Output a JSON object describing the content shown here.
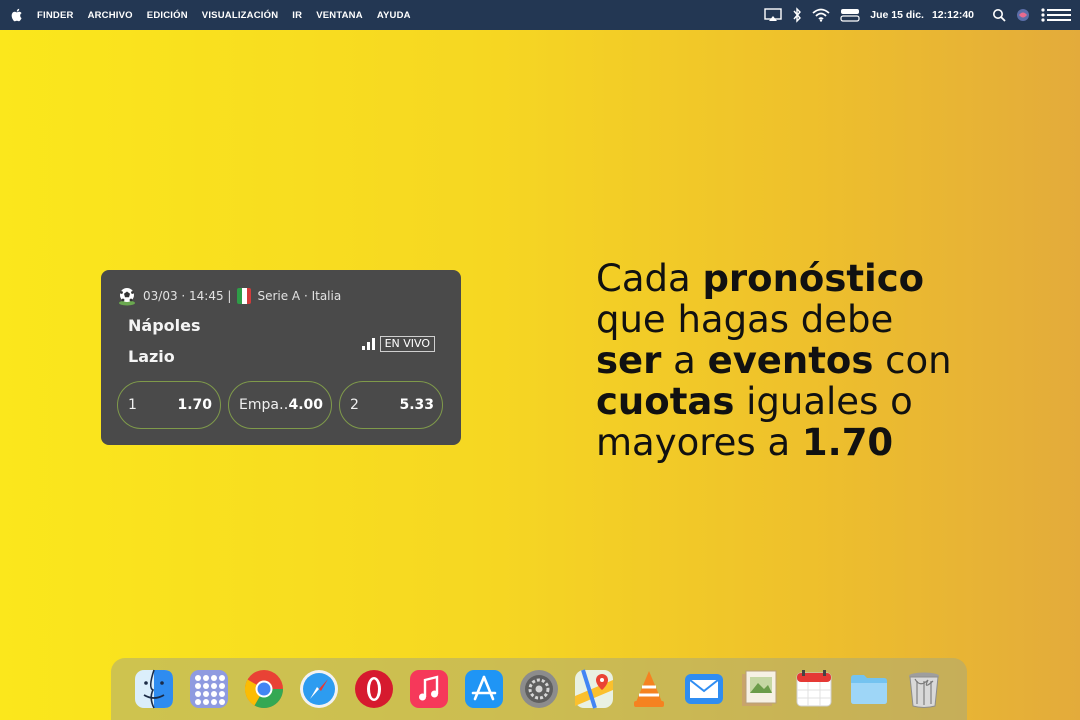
{
  "menubar": {
    "app_name": "FINDER",
    "items": [
      "ARCHIVO",
      "EDICIÓN",
      "VISUALIZACIÓN",
      "IR",
      "VENTANA",
      "AYUDA"
    ],
    "date": "Jue 15 dic.",
    "time": "12:12:40",
    "background": "#233753"
  },
  "match": {
    "date_time": "03/03 · 14:45 |",
    "league": "Serie A · Italia",
    "home_team": "Nápoles",
    "away_team": "Lazio",
    "live_label": "EN VIVO",
    "odds": [
      {
        "label": "1",
        "value": "1.70"
      },
      {
        "label": "Empa…",
        "value": "4.00"
      },
      {
        "label": "2",
        "value": "5.33"
      }
    ]
  },
  "promo": {
    "w1": "Cada",
    "w2": "pronóstico",
    "w3": "que hagas debe",
    "w4": "ser",
    "w5": "a",
    "w6": "eventos",
    "w7": "con",
    "w8": "cuotas",
    "w9": "iguales o",
    "w10": "mayores a",
    "w11": "1.70"
  },
  "dock": {
    "apps": [
      "finder-icon",
      "launchpad-icon",
      "chrome-icon",
      "safari-icon",
      "opera-icon",
      "music-icon",
      "app-store-icon",
      "system-preferences-icon",
      "maps-icon",
      "vlc-icon",
      "mail-icon",
      "preview-icon",
      "calendar-icon",
      "folder-icon",
      "trash-icon"
    ]
  }
}
